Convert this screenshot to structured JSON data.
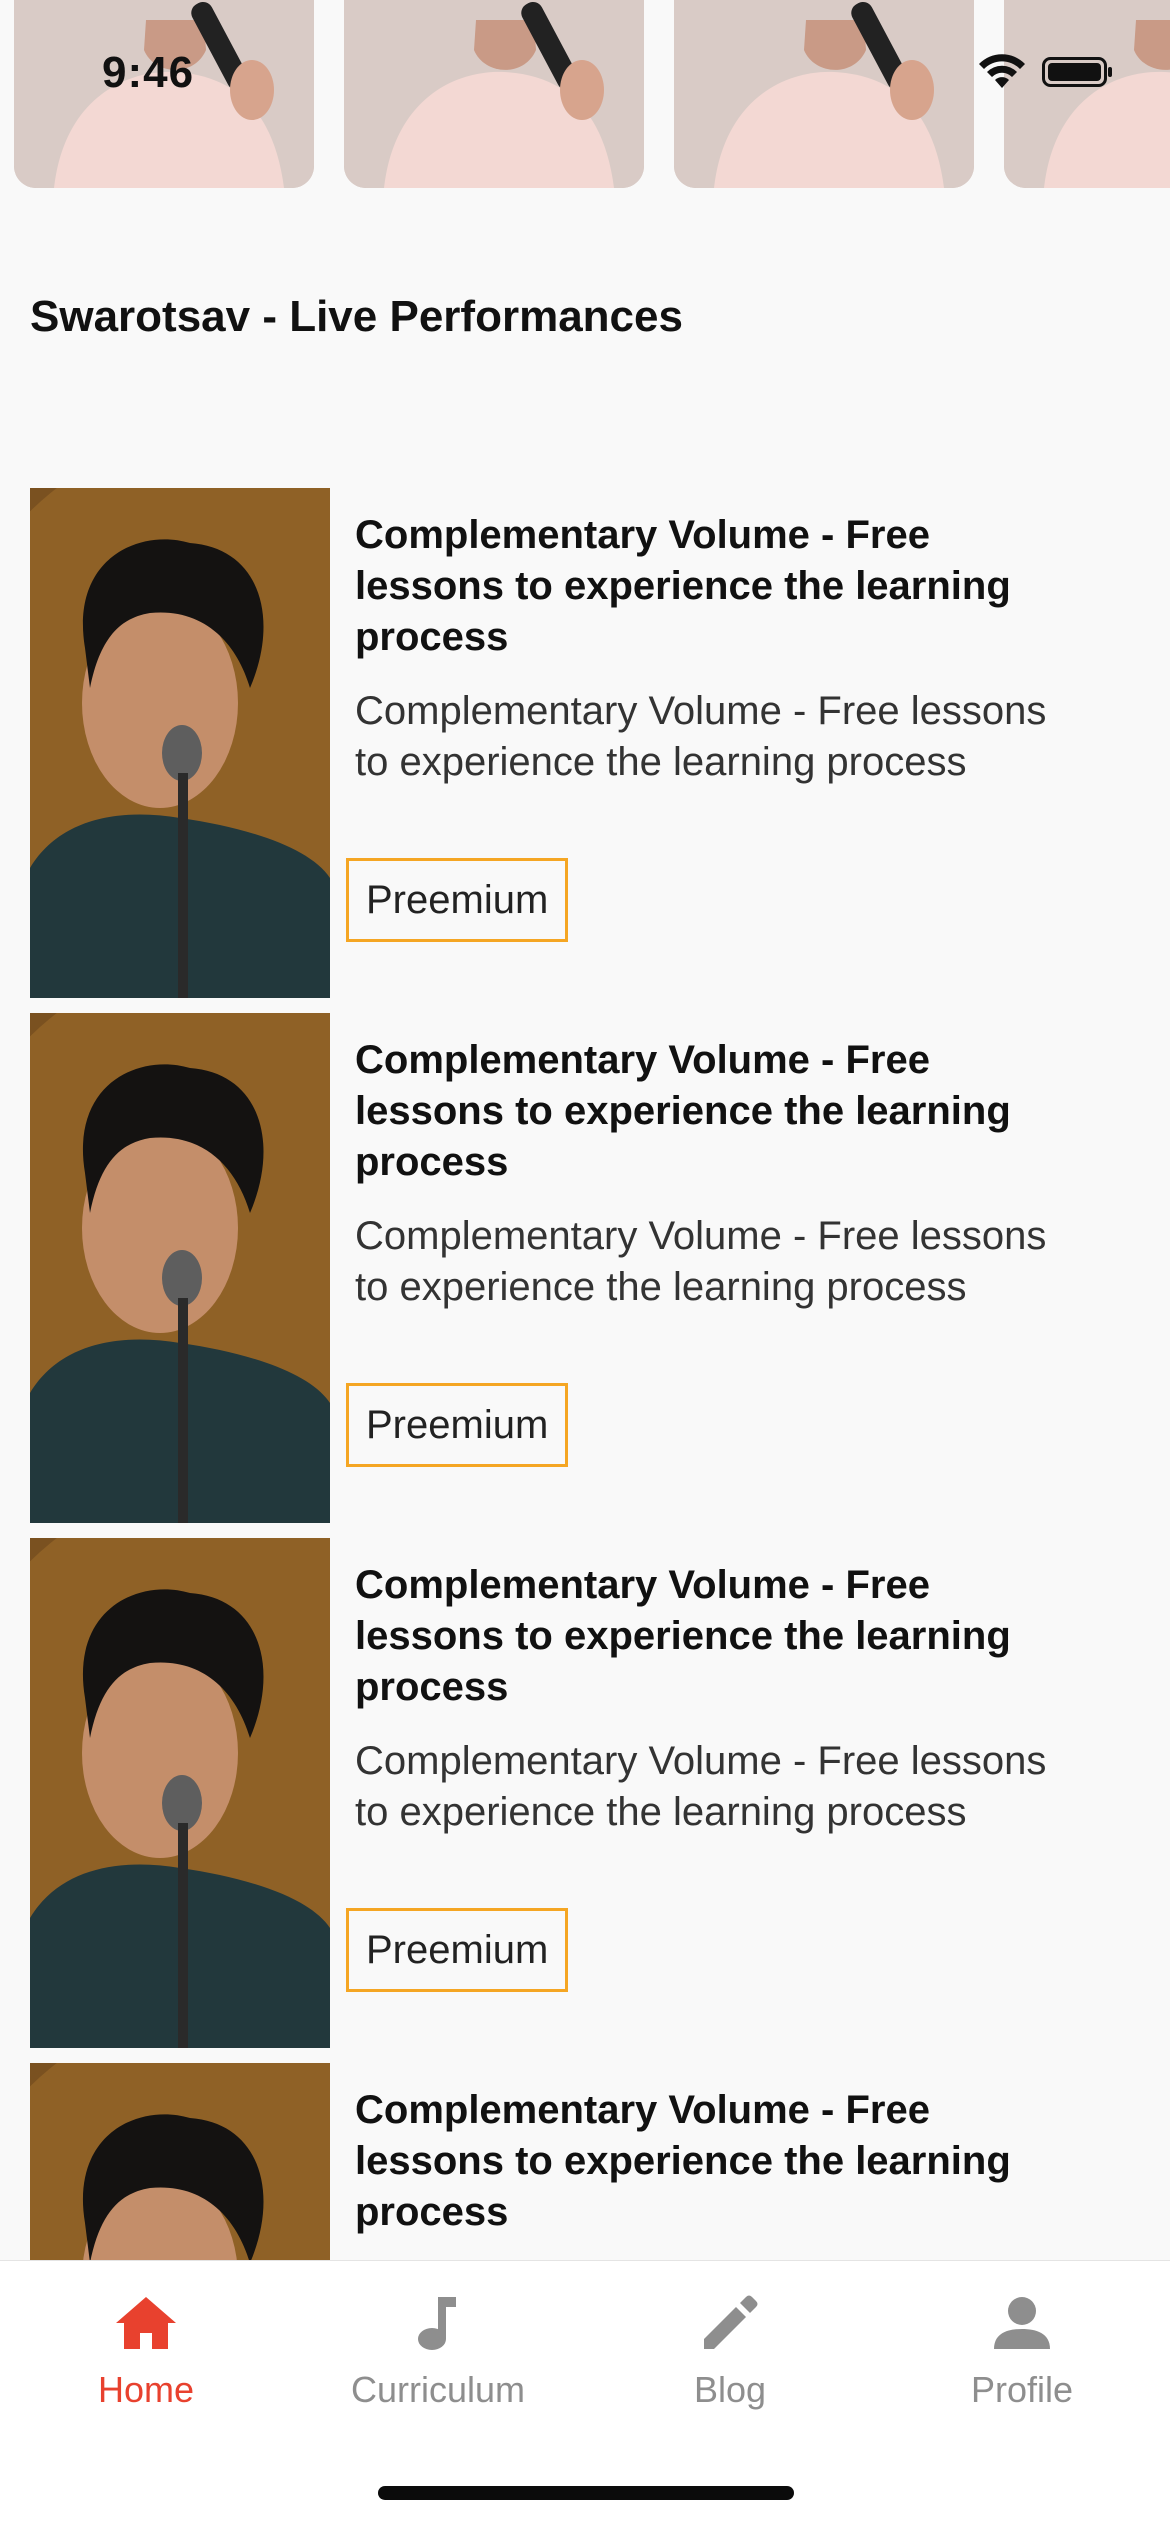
{
  "status_bar": {
    "time": "9:46"
  },
  "section": {
    "title": "Swarotsav - Live Performances"
  },
  "courses": [
    {
      "title": "Complementary Volume - Free lessons to experience the learning process",
      "description": "Complementary Volume - Free lessons to experience the learning process",
      "badge": "Preemium"
    },
    {
      "title": "Complementary Volume - Free lessons to experience the learning process",
      "description": "Complementary Volume - Free lessons to experience the learning process",
      "badge": "Preemium"
    },
    {
      "title": "Complementary Volume - Free lessons to experience the learning process",
      "description": "Complementary Volume - Free lessons to experience the learning process",
      "badge": "Preemium"
    },
    {
      "title": "Complementary Volume - Free lessons to experience the learning process",
      "description": "",
      "badge": ""
    }
  ],
  "bottom_nav": {
    "items": [
      {
        "label": "Home",
        "icon": "home-icon",
        "active": true
      },
      {
        "label": "Curriculum",
        "icon": "music-note-icon",
        "active": false
      },
      {
        "label": "Blog",
        "icon": "pencil-icon",
        "active": false
      },
      {
        "label": "Profile",
        "icon": "person-icon",
        "active": false
      }
    ]
  },
  "colors": {
    "accent": "#e8412e",
    "badge_border": "#f5a623",
    "nav_inactive": "#8e8e8e",
    "background": "#f9f9f9"
  }
}
